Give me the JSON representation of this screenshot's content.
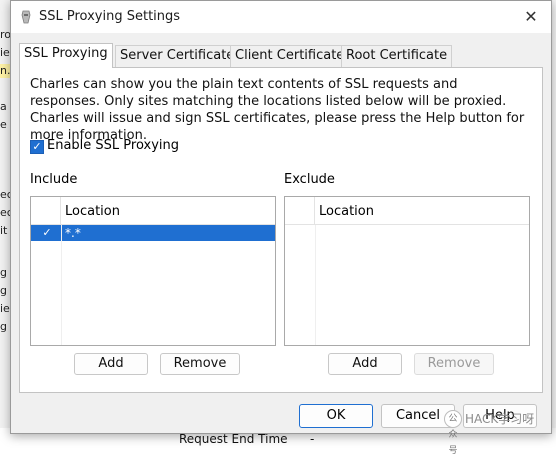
{
  "background": {
    "left_fragments": [
      "ro",
      "ie",
      "n.",
      "a",
      "e",
      "ec",
      "ec",
      "it",
      "g",
      "g",
      "ie",
      "g"
    ],
    "bottom_text": "Request End Time",
    "bottom_dash": "-"
  },
  "dialog": {
    "title": "SSL Proxying Settings",
    "close_symbol": "✕",
    "tabs": [
      {
        "label": "SSL Proxying",
        "active": true
      },
      {
        "label": "Server Certificates",
        "active": false
      },
      {
        "label": "Client Certificates",
        "active": false
      },
      {
        "label": "Root Certificate",
        "active": false
      }
    ],
    "description": "Charles can show you the plain text contents of SSL requests and responses. Only sites matching the locations listed below will be proxied. Charles will issue and sign SSL certificates, please press the Help button for more information.",
    "enable_checkbox": {
      "label": "Enable SSL Proxying",
      "checked": true,
      "check_symbol": "✓"
    },
    "include": {
      "label": "Include",
      "column_header": "Location",
      "rows": [
        {
          "checked": true,
          "location": "*.*"
        }
      ],
      "add_label": "Add",
      "remove_label": "Remove"
    },
    "exclude": {
      "label": "Exclude",
      "column_header": "Location",
      "rows": [],
      "add_label": "Add",
      "remove_label": "Remove",
      "remove_disabled": true
    },
    "footer": {
      "ok_label": "OK",
      "cancel_label": "Cancel",
      "help_label": "Help"
    }
  },
  "watermark": {
    "text": "HACK学习呀",
    "badge": "公众号"
  },
  "colors": {
    "accent": "#1f6fd1",
    "dialog_bg": "#f0f0f0",
    "panel_bg": "#ffffff"
  }
}
